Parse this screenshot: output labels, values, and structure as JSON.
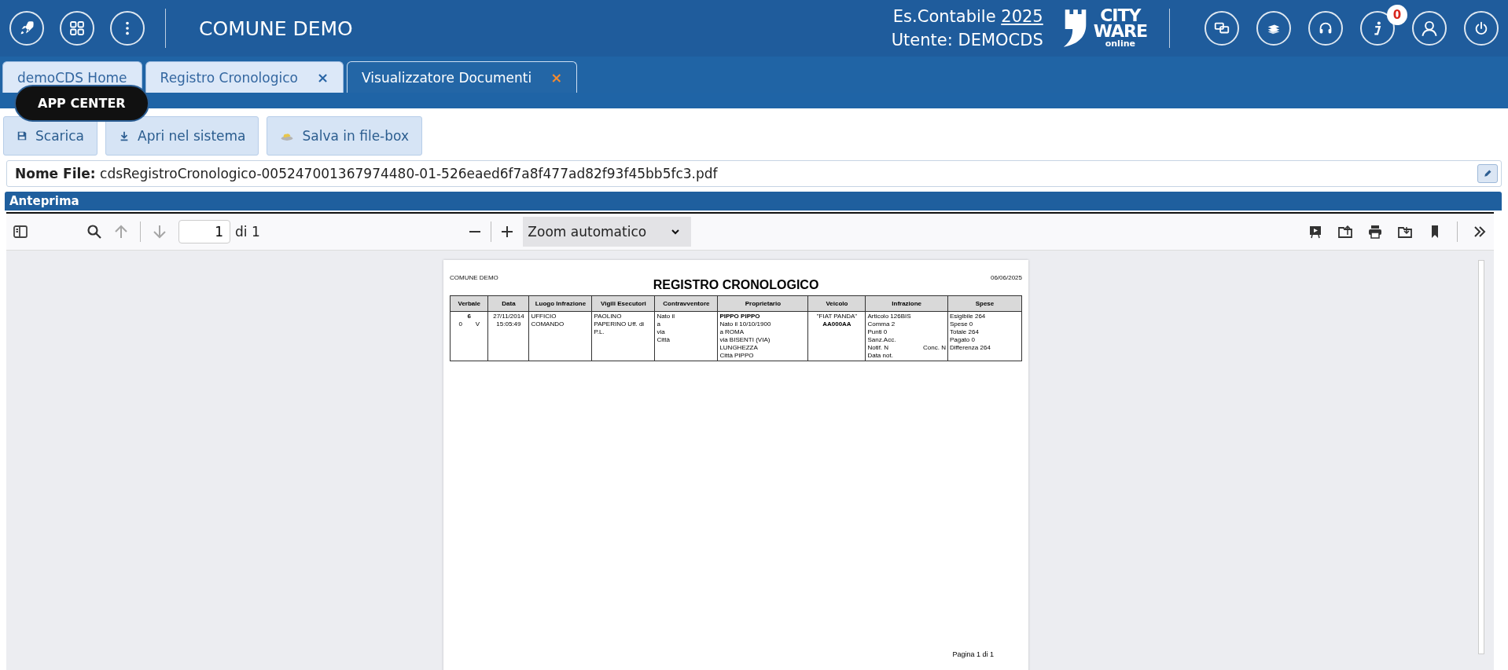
{
  "header": {
    "title": "COMUNE DEMO",
    "year_label": "Es.Contabile",
    "year": "2025",
    "user": "Utente: DEMOCDS",
    "logo": {
      "line1": "CITY",
      "line2": "WARE",
      "line3": "online"
    },
    "info_badge": "0"
  },
  "tooltip": {
    "text": "APP CENTER"
  },
  "tabs": [
    {
      "label": "demoCDS Home",
      "selected": false
    },
    {
      "label": "Registro Cronologico",
      "selected": false,
      "close": "×"
    },
    {
      "label": "Visualizzatore Documenti",
      "selected": true,
      "close": "×"
    }
  ],
  "buttons": [
    {
      "kind": "save",
      "label": "Scarica"
    },
    {
      "kind": "download",
      "label": "Apri nel sistema"
    },
    {
      "kind": "cloud",
      "label": "Salva in file-box"
    }
  ],
  "file": {
    "label": "Nome File:",
    "value": "cdsRegistroCronologico-005247001367974480-01-526eaed6f7a8f477ad82f93f45bb5fc3.pdf"
  },
  "section_title": "Anteprima",
  "viewer": {
    "page_value": "1",
    "page_total": "di 1",
    "zoom": "Zoom automatico",
    "up_disabled": true,
    "down_disabled": true,
    "document": {
      "org": "COMUNE DEMO",
      "date": "06/06/2025",
      "title": "REGISTRO CRONOLOGICO",
      "footer": "Pagina 1 di 1",
      "columns": [
        "Verbale",
        "Data",
        "Luogo Infrazione",
        "Vigili Esecutori",
        "Contravventore",
        "Proprietario",
        "Veicolo",
        "Infrazione",
        "Spese"
      ],
      "rows": [
        [
          {
            "lines": [
              {
                "parts": [
                  "6"
                ],
                "bold": true
              },
              {
                "parts": [
                  "0",
                  "V"
                ],
                "bold": false
              }
            ]
          },
          {
            "lines": [
              {
                "parts": [
                  "27/11/2014"
                ],
                "bold": false
              },
              {
                "parts": [
                  "15:05:49"
                ],
                "bold": false
              }
            ]
          },
          {
            "lines": [
              {
                "parts": [
                  "UFFICIO COMANDO"
                ],
                "bold": false
              }
            ]
          },
          {
            "lines": [
              {
                "parts": [
                  "PAOLINO PAPERINO  Uff. di P.L."
                ],
                "bold": false
              }
            ]
          },
          {
            "lines": [
              {
                "parts": [
                  "Nato il"
                ],
                "bold": false
              },
              {
                "parts": [
                  "a"
                ],
                "bold": false
              },
              {
                "parts": [
                  "via"
                ],
                "bold": false
              },
              {
                "parts": [
                  "Città"
                ],
                "bold": false
              }
            ]
          },
          {
            "lines": [
              {
                "parts": [
                  "PIPPO PIPPO"
                ],
                "bold": true
              },
              {
                "parts": [
                  "Nato il 10/10/1900"
                ],
                "bold": false
              },
              {
                "parts": [
                  "a ROMA"
                ],
                "bold": false
              },
              {
                "parts": [
                  "via BISENTI (VIA) LUNGHEZZA"
                ],
                "bold": false
              },
              {
                "parts": [
                  "Città PIPPO"
                ],
                "bold": false
              }
            ]
          },
          {
            "lines": [
              {
                "parts": [
                  "\"FIAT PANDA\""
                ],
                "bold": false
              },
              {
                "parts": [
                  "AA000AA"
                ],
                "bold": true
              }
            ]
          },
          {
            "lines": [
              {
                "parts": [
                  "Articolo 126BIS"
                ],
                "bold": false
              },
              {
                "parts": [
                  "Comma 2"
                ],
                "bold": false
              },
              {
                "parts": [
                  "Punti 0"
                ],
                "bold": false
              },
              {
                "parts": [
                  "Sanz.Acc."
                ],
                "bold": false
              },
              {
                "parts": [
                  "Notif. N",
                  "Conc. N"
                ],
                "bold": false
              },
              {
                "parts": [
                  "Data not."
                ],
                "bold": false
              }
            ]
          },
          {
            "lines": [
              {
                "parts": [
                  "Esigibile 264"
                ],
                "bold": false
              },
              {
                "parts": [
                  "Spese 0"
                ],
                "bold": false
              },
              {
                "parts": [
                  "Totale 264"
                ],
                "bold": false
              },
              {
                "parts": [
                  "Pagato 0"
                ],
                "bold": false
              },
              {
                "parts": [
                  "Differenza 264"
                ],
                "bold": false
              }
            ]
          }
        ]
      ]
    }
  }
}
